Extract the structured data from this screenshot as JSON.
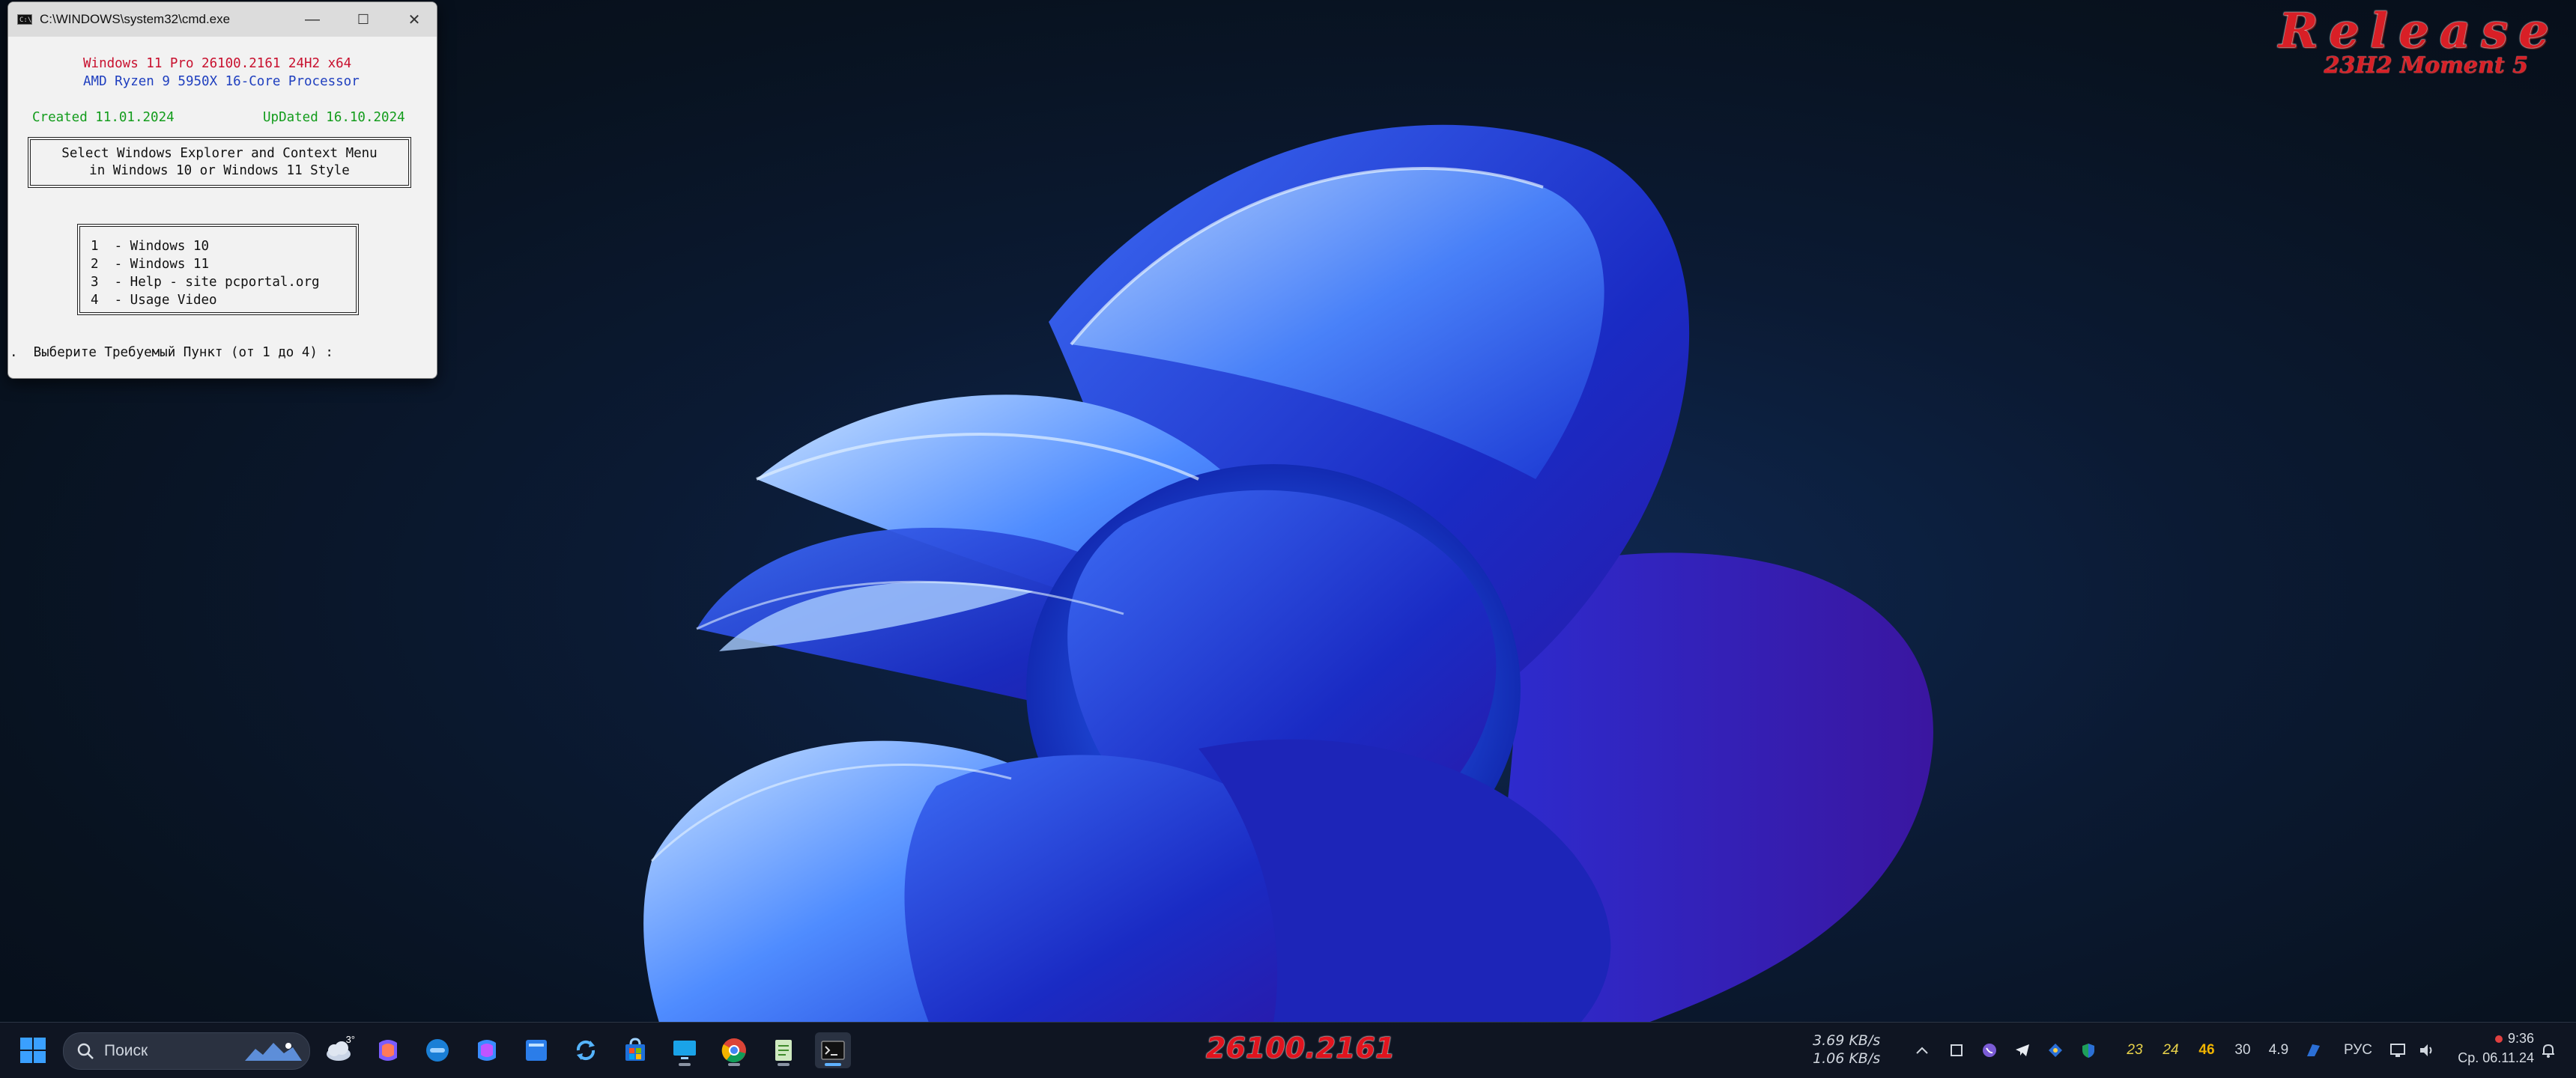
{
  "watermark": {
    "release": "Release",
    "moment": "23H2 Moment 5"
  },
  "cmd": {
    "title": "C:\\WINDOWS\\system32\\cmd.exe",
    "controls": {
      "minimize": "—",
      "maximize": "☐",
      "close": "✕"
    },
    "os_line": "Windows 11 Pro 26100.2161 24H2 x64",
    "cpu_line": "AMD Ryzen 9 5950X 16-Core Processor",
    "created": "Created 11.01.2024",
    "updated": "UpDated 16.10.2024",
    "heading_1": "Select Windows Explorer and Context Menu",
    "heading_2": "in Windows 10 or Windows 11 Style",
    "menu": [
      "1  - Windows 10",
      "2  - Windows 11",
      "3  - Help - site pcportal.org",
      "4  - Usage Video"
    ],
    "prompt": ".  Выберите Требуемый Пункт (от 1 до 4) :"
  },
  "taskbar": {
    "search_placeholder": "Поиск",
    "weather_temp": "3°",
    "build_stamp": "26100.2161",
    "net_up": "3.69 KB/s",
    "net_down": "1.06 KB/s",
    "tray_numbers": [
      "23",
      "24",
      "46",
      "30",
      "4.9"
    ],
    "tray_number_colors": [
      "#e8d24a",
      "#e8d24a",
      "#f0b400",
      "#d0d6de",
      "#d0d6de"
    ],
    "language": "РУС",
    "time": "9:36",
    "date": "Ср. 06.11.24"
  },
  "colors": {
    "accent_red": "#d81f26",
    "cmd_red": "#c8102e",
    "cmd_blue": "#1f3fbf",
    "cmd_green": "#139c1c",
    "taskbar_bg": "#101622"
  }
}
